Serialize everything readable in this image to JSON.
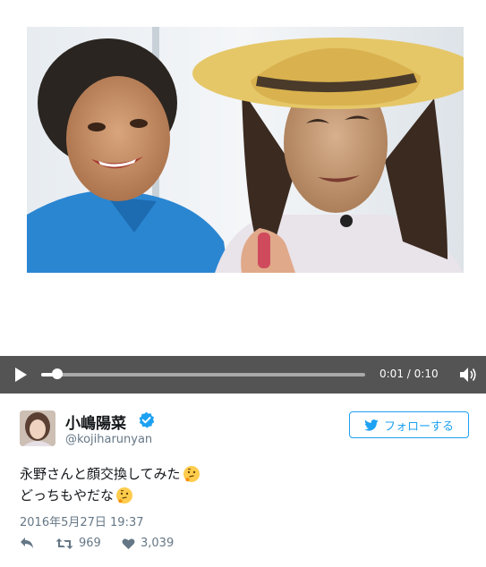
{
  "video": {
    "current_time": "0:01",
    "separator": "/",
    "duration": "0:10",
    "progress": 0.05
  },
  "user": {
    "display_name": "小嶋陽菜",
    "handle": "@kojiharunyan",
    "verified": true
  },
  "follow_button": {
    "label": "フォローする"
  },
  "tweet": {
    "lines": [
      "永野さんと顔交換してみた",
      "どっちもやだな"
    ],
    "emoji": "thinking-face",
    "timestamp": "2016年5月27日 19:37"
  },
  "actions": {
    "retweets": "969",
    "likes": "3,039"
  },
  "colors": {
    "accent": "#1da1f2",
    "controls_bg": "#545454",
    "secondary_text": "#657786"
  },
  "icons": [
    "play-icon",
    "volume-icon",
    "verified-icon",
    "twitter-bird-icon",
    "reply-icon",
    "retweet-icon",
    "heart-icon",
    "thinking-face-emoji"
  ]
}
